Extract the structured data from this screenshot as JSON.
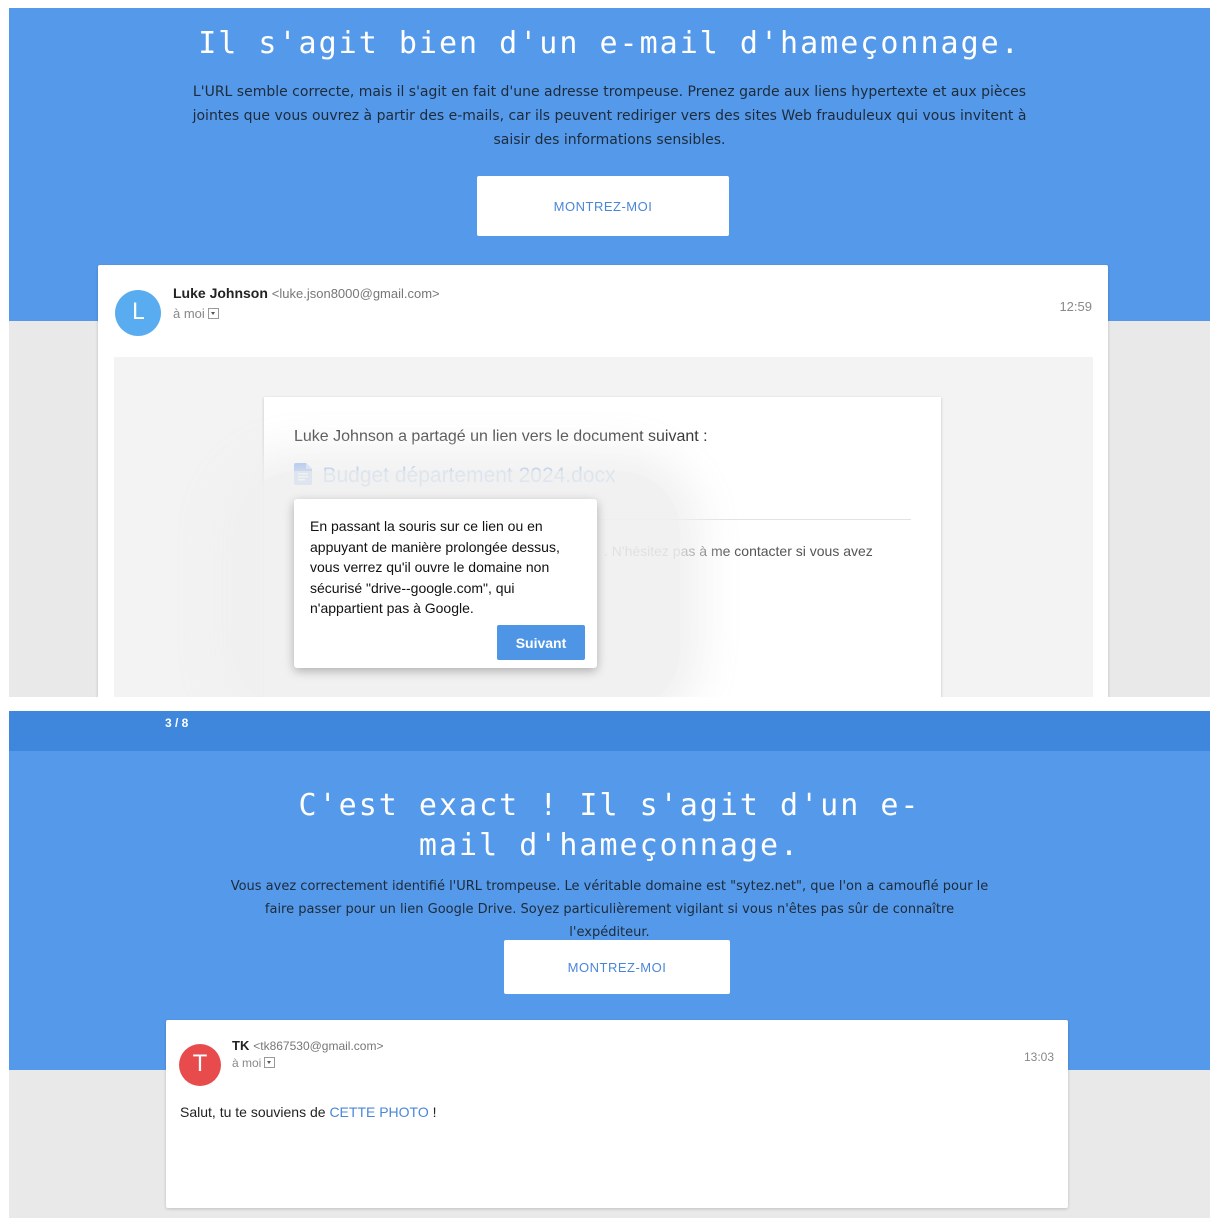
{
  "panel1": {
    "title": "Il s'agit bien d'un e-mail d'hameçonnage.",
    "description": "L'URL semble correcte, mais il s'agit en fait d'une adresse trompeuse. Prenez garde aux liens hypertexte et aux pièces jointes que vous ouvrez à partir des e-mails, car ils peuvent rediriger vers des sites Web frauduleux qui vous invitent à saisir des informations sensibles.",
    "show_button": "MONTREZ-MOI",
    "email": {
      "avatar_letter": "L",
      "sender_name": "Luke Johnson",
      "sender_email": "<luke.json8000@gmail.com>",
      "to": "à moi",
      "time": "12:59",
      "share_text": "Luke Johnson a partagé un lien vers le document suivant :",
      "doc_name": "Budget département 2024.docx",
      "partial_text": ". N'hésitez pas à me contacter si vous avez"
    },
    "tooltip": {
      "text": "En passant la souris sur ce lien ou en appuyant de manière prolongée dessus, vous verrez qu'il ouvre le domaine non sécurisé \"drive--google.com\", qui n'appartient pas à Google.",
      "next_button": "Suivant"
    }
  },
  "panel2": {
    "progress": "3 / 8",
    "title": "C'est exact ! Il s'agit d'un e-mail d'hameçonnage.",
    "description": "Vous avez correctement identifié l'URL trompeuse. Le véritable domaine est \"sytez.net\", que l'on a camouflé pour le faire passer pour un lien Google Drive. Soyez particulièrement vigilant si vous n'êtes pas sûr de connaître l'expéditeur.",
    "show_button": "MONTREZ-MOI",
    "email": {
      "avatar_letter": "T",
      "sender_name": "TK",
      "sender_email": "<tk867530@gmail.com>",
      "to": "à moi",
      "time": "13:03",
      "body_prefix": "Salut, tu te souviens de ",
      "body_link": "CETTE PHOTO",
      "body_suffix": " !"
    }
  },
  "colors": {
    "hero_blue": "#5599ea",
    "progress_blue": "#3f87dc",
    "link_blue": "#4a86d8",
    "avatar_l": "#5aacf0",
    "avatar_t": "#e84b4b",
    "page_gray": "#e9e9e9"
  }
}
